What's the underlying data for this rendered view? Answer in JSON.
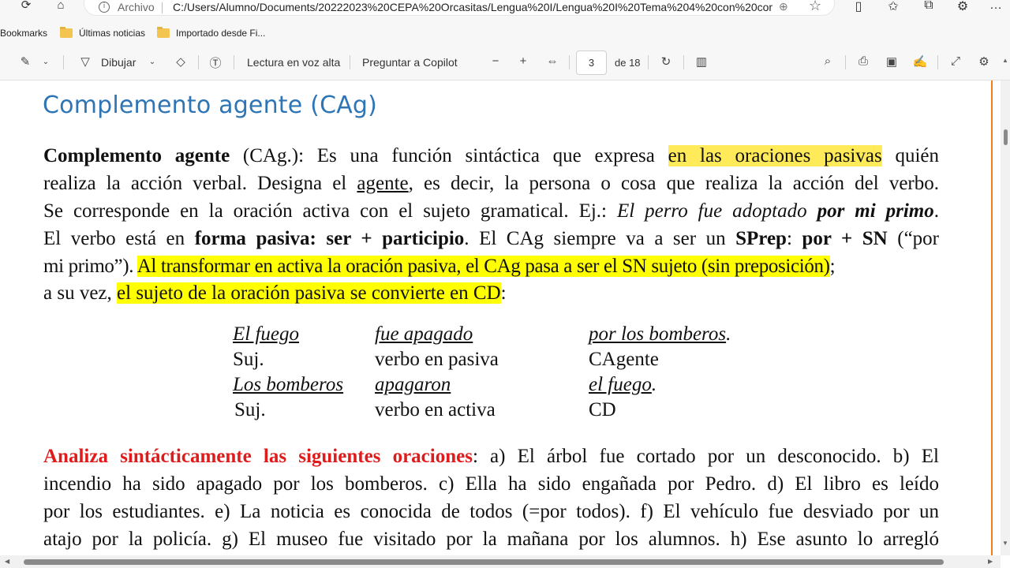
{
  "browser": {
    "url_label": "Archivo",
    "url": "C:/Users/Alumno/Documents/20222023%20CEPA%20Orcasitas/Lengua%20I/Lengua%20I%20Tema%204%20con%20com...",
    "bookmarks_label": "Bookmarks",
    "bookmarks": [
      {
        "label": "Últimas noticias"
      },
      {
        "label": "Importado desde Fi..."
      }
    ]
  },
  "pdf_toolbar": {
    "draw_label": "Dibujar",
    "read_aloud_label": "Lectura en voz alta",
    "copilot_label": "Preguntar a Copilot",
    "page_current": "3",
    "page_total_label": "de 18"
  },
  "document": {
    "heading": "Complemento agente (CAg)",
    "paragraph1": {
      "l1_a": "Complemento agente",
      "l1_b": " (CAg.): Es una función sintáctica que expresa ",
      "l1_hl": "en las oraciones pasivas",
      "l1_c": " quién",
      "l2_a": "realiza la acción verbal. Designa el ",
      "l2_u": "agente",
      "l2_b": ", es decir, la persona o cosa que realiza la acción del verbo.",
      "l3_a": "Se corresponde en la oración activa con el sujeto gramatical. Ej.: ",
      "l3_i": "El perro fue adoptado ",
      "l3_bi": "por mi primo",
      "l3_c": ".",
      "l4_a": "El verbo está en ",
      "l4_b1": "forma pasiva: ser + participio",
      "l4_c": ". El CAg siempre va a ser un ",
      "l4_b2": "SPrep",
      "l4_d": ": ",
      "l4_b3": "por + SN",
      "l4_e": " (“por",
      "l5_a": "mi primo”). ",
      "l5_hl": "Al transformar en activa la oración pasiva, el CAg pasa a ser el SN sujeto (sin preposición)",
      "l5_b": ";",
      "l6_a": "a su vez, ",
      "l6_hl": "el sujeto de la oración pasiva se convierte en CD",
      "l6_b": ":"
    },
    "examples": [
      {
        "c1": "El fuego",
        "c2": "fue apagado",
        "c3": "por los bomberos",
        "c3_end": "."
      },
      {
        "c1": "Suj.",
        "c2": "verbo en pasiva",
        "c3": "CAgente",
        "c3_end": ""
      },
      {
        "c1": "Los bomberos",
        "c2": "apagaron",
        "c3": "el fuego",
        "c3_end": "."
      },
      {
        "c1": "Suj.",
        "c2": "verbo en activa",
        "c3": "CD",
        "c3_end": ""
      }
    ],
    "exercise": {
      "title": "Analiza sintácticamente las siguientes oraciones",
      "l1": ": a) El árbol fue cortado por un desconocido. b) El",
      "l2": "incendio ha sido apagado por los bomberos. c) Ella ha sido engañada por Pedro. d) El libro es leído",
      "l3": "por los estudiantes. e) La noticia es conocida de todos (=por todos). f) El vehículo fue desviado por un",
      "l4": "atajo por la policía. g) El museo fue visitado por la mañana por los alumnos. h) Ese asunto lo arregló"
    }
  },
  "colors": {
    "heading": "#2e75b6",
    "highlight": "#ffff00",
    "highlight_soft": "#ffea59",
    "exercise_title": "#e01b1b",
    "scroll_accent": "#f27f1b"
  }
}
